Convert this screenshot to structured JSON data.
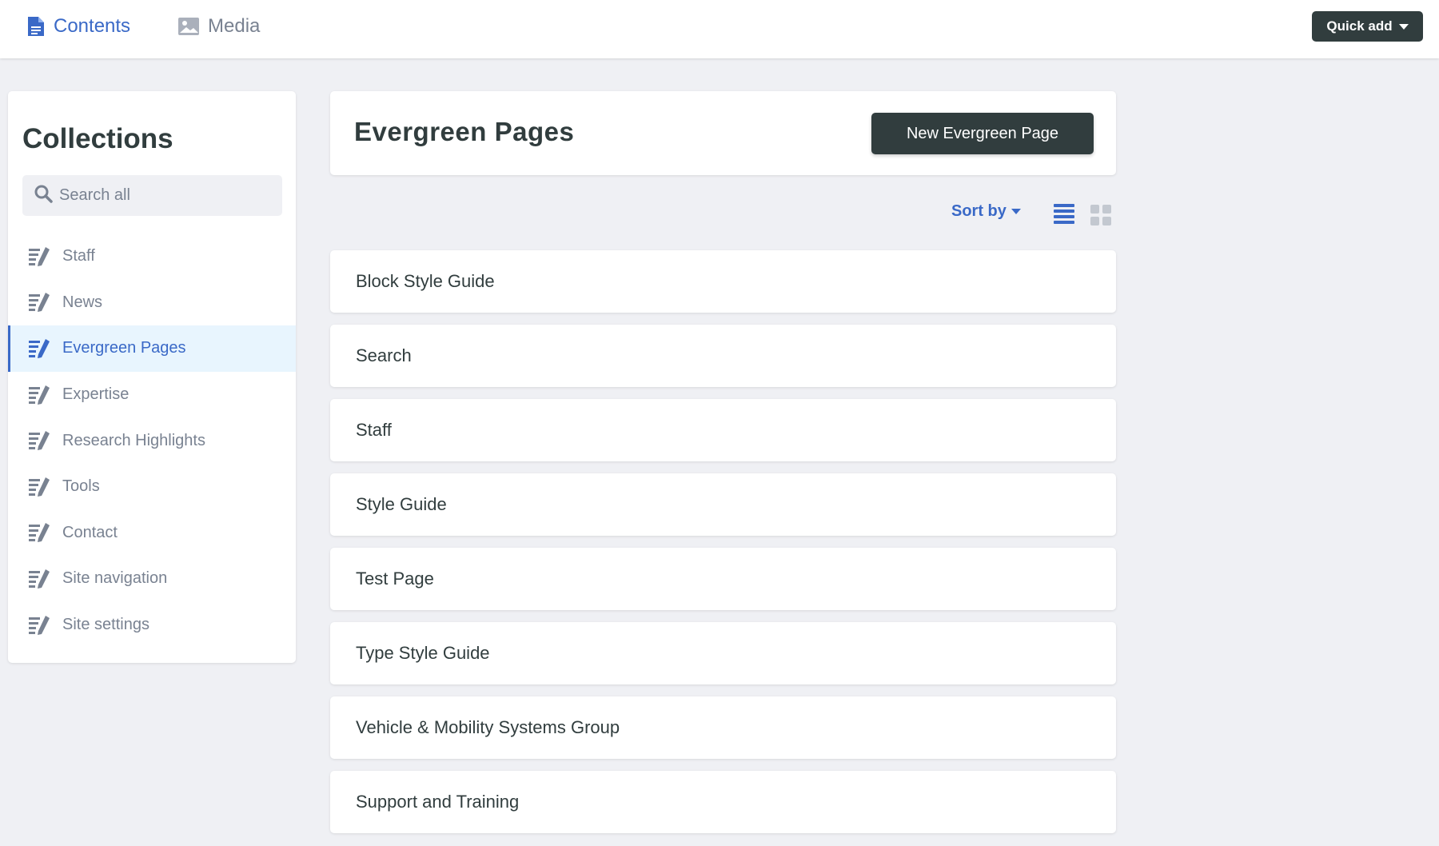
{
  "topbar": {
    "contents_label": "Contents",
    "media_label": "Media",
    "quick_add_label": "Quick add",
    "active_color": "#3a69c7",
    "inactive_color": "#798291"
  },
  "sidebar": {
    "title": "Collections",
    "search_placeholder": "Search all",
    "active_index": 2,
    "items": [
      {
        "label": "Staff",
        "icon": "edit-list-icon"
      },
      {
        "label": "News",
        "icon": "edit-list-icon"
      },
      {
        "label": "Evergreen Pages",
        "icon": "edit-list-icon"
      },
      {
        "label": "Expertise",
        "icon": "edit-list-icon"
      },
      {
        "label": "Research Highlights",
        "icon": "edit-list-icon"
      },
      {
        "label": "Tools",
        "icon": "edit-list-icon"
      },
      {
        "label": "Contact",
        "icon": "edit-list-icon"
      },
      {
        "label": "Site navigation",
        "icon": "edit-list-icon"
      },
      {
        "label": "Site settings",
        "icon": "edit-list-icon"
      }
    ]
  },
  "main": {
    "title": "Evergreen Pages",
    "new_button_label": "New Evergreen Page",
    "sort_label": "Sort by",
    "view_mode": "list",
    "entries": [
      "Block Style Guide",
      "Search",
      "Staff",
      "Style Guide",
      "Test Page",
      "Type Style Guide",
      "Vehicle & Mobility Systems Group",
      "Support and Training"
    ]
  }
}
